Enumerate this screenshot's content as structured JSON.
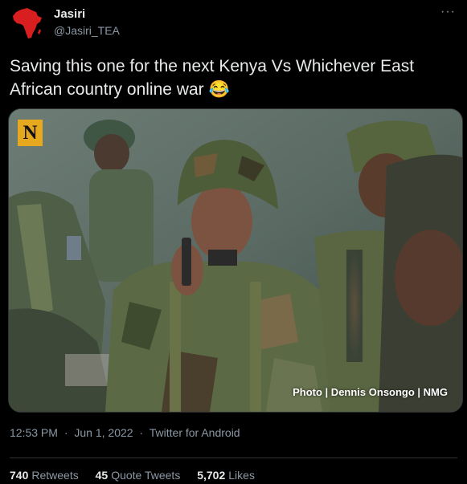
{
  "user": {
    "name": "Jasiri",
    "handle": "@Jasiri_TEA"
  },
  "tweet": {
    "text": "Saving this one for the next Kenya Vs Whichever East African country online war 😂"
  },
  "media": {
    "logo_letter": "N",
    "credit": "Photo | Dennis Onsongo | NMG"
  },
  "meta": {
    "time": "12:53 PM",
    "separator": "·",
    "date": "Jun 1, 2022",
    "client": "Twitter for Android"
  },
  "stats": {
    "retweets_count": "740",
    "retweets_label": "Retweets",
    "quotes_count": "45",
    "quotes_label": "Quote Tweets",
    "likes_count": "5,702",
    "likes_label": "Likes"
  },
  "colors": {
    "background": "#000000",
    "text_primary": "#e7e9ea",
    "text_secondary": "#8b98a5",
    "avatar_africa": "#d81e1e",
    "logo_bg": "#e6a81f"
  },
  "icons": [
    "africa-avatar-icon",
    "more-options-icon"
  ]
}
